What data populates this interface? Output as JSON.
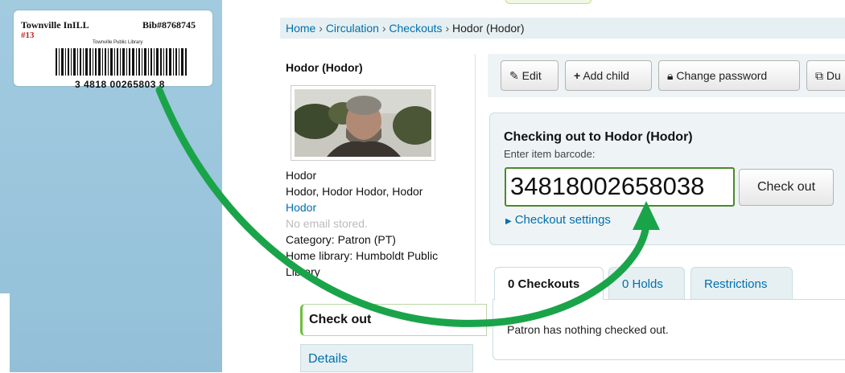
{
  "label": {
    "title": "Townville InILL",
    "bib": "Bib#8768745",
    "number": "#13",
    "library": "Townville Public Library",
    "digits": "3 4818 00265803 8"
  },
  "breadcrumb": {
    "items": [
      "Home",
      "Circulation",
      "Checkouts"
    ],
    "current": "Hodor (Hodor)"
  },
  "patron": {
    "name": "Hodor (Hodor)",
    "line1": "Hodor",
    "line2": "Hodor, Hodor Hodor, Hodor",
    "link": "Hodor",
    "email": "No email stored.",
    "category": "Category: Patron (PT)",
    "home_library": "Home library: Humboldt Public Library"
  },
  "menu": {
    "checkout": "Check out",
    "details": "Details"
  },
  "toolbar": {
    "edit": "Edit",
    "add_child": "Add child",
    "change_password": "Change password",
    "duplicate": "Du"
  },
  "checkout": {
    "title": "Checking out to Hodor (Hodor)",
    "hint": "Enter item barcode:",
    "barcode_value": "34818002658038",
    "button": "Check out",
    "settings": "Checkout settings"
  },
  "tabs": {
    "checkouts": "0 Checkouts",
    "holds": "0 Holds",
    "restrictions": "Restrictions",
    "message": "Patron has nothing checked out."
  },
  "colors": {
    "arrow": "#1aa44a",
    "link": "#006faf",
    "accent_green": "#4a8a2a"
  }
}
